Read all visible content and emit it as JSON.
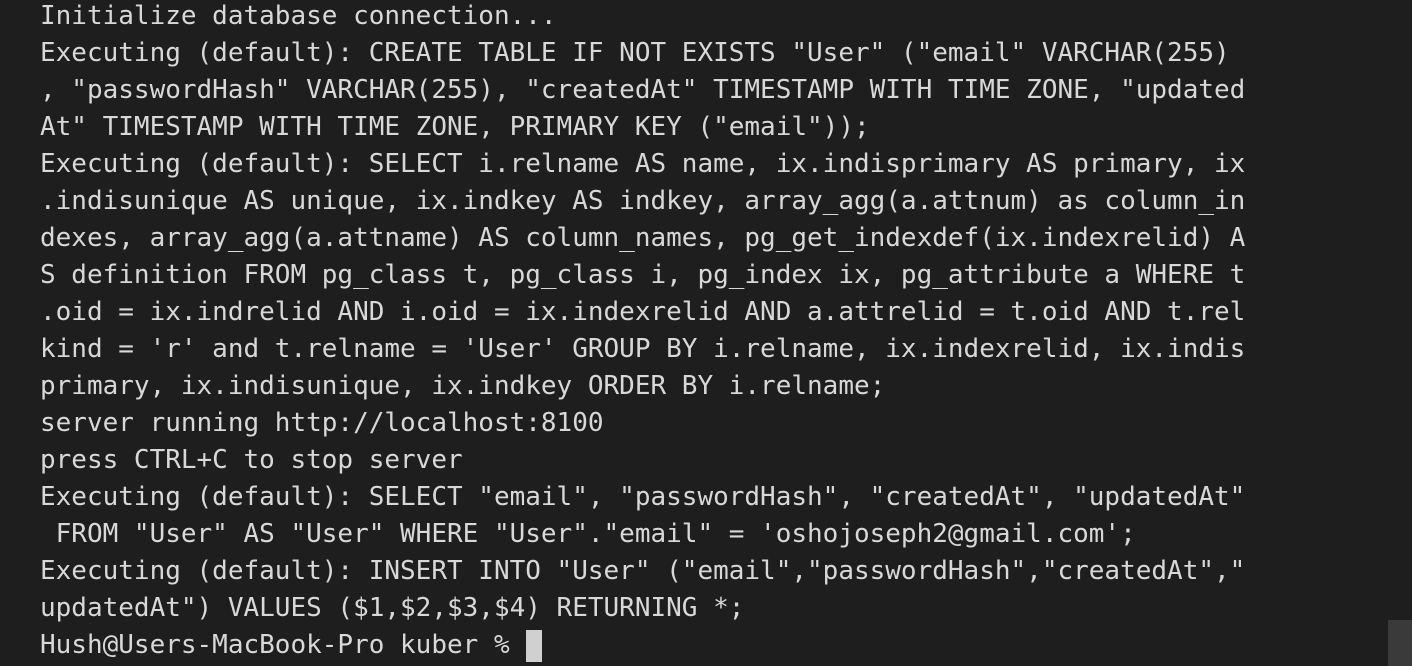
{
  "terminal": {
    "lines": [
      "Initialize database connection...",
      "Executing (default): CREATE TABLE IF NOT EXISTS \"User\" (\"email\" VARCHAR(255)",
      ", \"passwordHash\" VARCHAR(255), \"createdAt\" TIMESTAMP WITH TIME ZONE, \"updated",
      "At\" TIMESTAMP WITH TIME ZONE, PRIMARY KEY (\"email\"));",
      "Executing (default): SELECT i.relname AS name, ix.indisprimary AS primary, ix",
      ".indisunique AS unique, ix.indkey AS indkey, array_agg(a.attnum) as column_in",
      "dexes, array_agg(a.attname) AS column_names, pg_get_indexdef(ix.indexrelid) A",
      "S definition FROM pg_class t, pg_class i, pg_index ix, pg_attribute a WHERE t",
      ".oid = ix.indrelid AND i.oid = ix.indexrelid AND a.attrelid = t.oid AND t.rel",
      "kind = 'r' and t.relname = 'User' GROUP BY i.relname, ix.indexrelid, ix.indis",
      "primary, ix.indisunique, ix.indkey ORDER BY i.relname;",
      "server running http://localhost:8100",
      "press CTRL+C to stop server",
      "Executing (default): SELECT \"email\", \"passwordHash\", \"createdAt\", \"updatedAt\"",
      " FROM \"User\" AS \"User\" WHERE \"User\".\"email\" = 'oshojoseph2@gmail.com';",
      "Executing (default): INSERT INTO \"User\" (\"email\",\"passwordHash\",\"createdAt\",\"",
      "updatedAt\") VALUES ($1,$2,$3,$4) RETURNING *;"
    ],
    "prompt": "Hush@Users-MacBook-Pro kuber %"
  }
}
